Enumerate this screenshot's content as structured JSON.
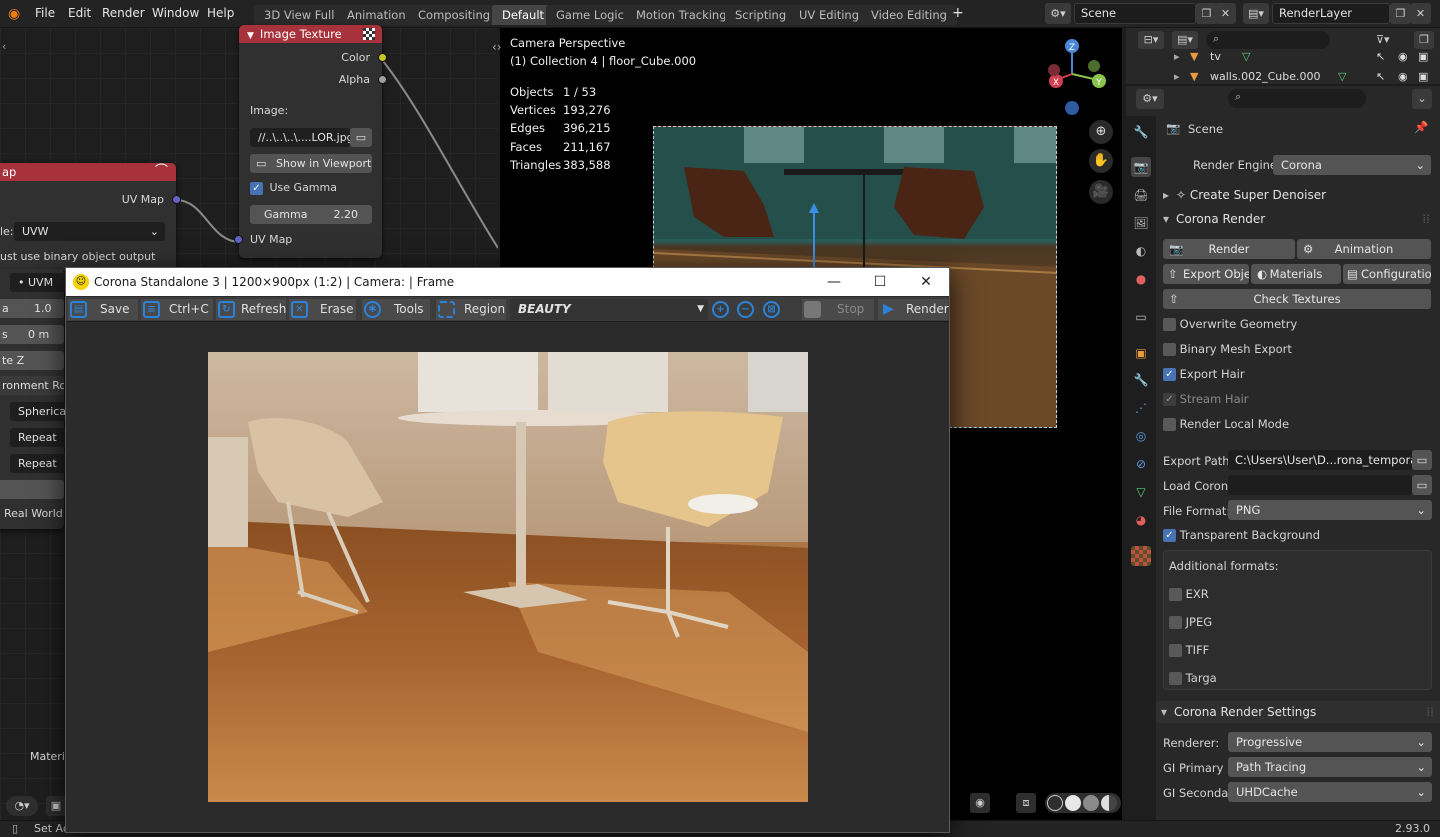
{
  "menubar": {
    "items": [
      "File",
      "Edit",
      "Render",
      "Window",
      "Help"
    ],
    "workspaces": [
      "3D View Full",
      "Animation",
      "Compositing",
      "Default",
      "Game Logic",
      "Motion Tracking",
      "Scripting",
      "UV Editing",
      "Video Editing"
    ],
    "active_workspace": "Default",
    "add_tab": "+",
    "scene": "Scene",
    "view_layer": "RenderLayer"
  },
  "node_editor": {
    "image_texture": {
      "title": "Image Texture",
      "out_color": "Color",
      "out_alpha": "Alpha",
      "image_label": "Image:",
      "image_file": "//..\\..\\..\\....LOR.jpg",
      "show_viewport": "Show in Viewport",
      "use_gamma": "Use Gamma",
      "gamma_label": "Gamma",
      "gamma_value": "2.20",
      "in_uvmap": "UV Map"
    },
    "uvmap_node": {
      "title": "ap",
      "out_uvmap": "UV Map",
      "mode_label": "le:",
      "mode_value": "UVW",
      "binary_text": "ust use binary object output"
    },
    "left_partial": {
      "uvmap_field": "UVM",
      "val1_label": "a",
      "val1": "1.0",
      "val2_label": "s",
      "val2": "0 m",
      "z_label": "te Z",
      "env_label": "ronment Rota",
      "spherical": "Spherical",
      "repeat1": "Repeat",
      "repeat2": "Repeat",
      "real_world": "Real World S",
      "material": "Materia"
    }
  },
  "viewport": {
    "mode": "Camera Perspective",
    "collection": "(1) Collection 4 | floor_Cube.000",
    "stats": [
      {
        "label": "Objects",
        "value": "1 / 53"
      },
      {
        "label": "Vertices",
        "value": "193,276"
      },
      {
        "label": "Edges",
        "value": "396,215"
      },
      {
        "label": "Faces",
        "value": "211,167"
      },
      {
        "label": "Triangles",
        "value": "383,588"
      }
    ],
    "gizmo": {
      "z": "Z",
      "x": "X",
      "y": "Y"
    }
  },
  "corona_window": {
    "title": "Corona Standalone 3 | 1200×900px (1:2) | Camera:  | Frame",
    "toolbar": {
      "save": "Save",
      "copy": "Ctrl+C",
      "refresh": "Refresh",
      "erase": "Erase",
      "tools": "Tools",
      "region": "Region",
      "channel": "BEAUTY",
      "stop": "Stop",
      "render": "Render"
    }
  },
  "outliner": {
    "items": [
      {
        "name": "tv"
      },
      {
        "name": "walls.002_Cube.000"
      }
    ]
  },
  "properties": {
    "scene_label": "Scene",
    "render_engine_label": "Render Engine",
    "render_engine": "Corona",
    "create_denoiser": "Create Super Denoiser",
    "corona_render_panel": "Corona Render",
    "btn_render": "Render",
    "btn_animation": "Animation",
    "btn_export": "Export Obje...",
    "btn_materials": "Materials",
    "btn_configuration": "Configuration",
    "btn_check_textures": "Check Textures",
    "checks": [
      {
        "label": "Overwrite Geometry",
        "checked": false
      },
      {
        "label": "Binary Mesh Export",
        "checked": false
      },
      {
        "label": "Export Hair",
        "checked": true
      },
      {
        "label": "Stream Hair",
        "checked": true
      },
      {
        "label": "Render Local Mode",
        "checked": false
      }
    ],
    "export_path_label": "Export Path:",
    "export_path": "C:\\Users\\User\\D...rona_temporary\\",
    "load_corona_label": "Load Coron...",
    "file_format_label": "File Format:",
    "file_format": "PNG",
    "transparent_bg": "Transparent Background",
    "additional_formats_label": "Additional formats:",
    "formats": [
      "EXR",
      "JPEG",
      "TIFF",
      "Targa"
    ],
    "render_settings_panel": "Corona Render Settings",
    "renderer_label": "Renderer:",
    "renderer": "Progressive",
    "gi_primary_label": "GI Primary ...",
    "gi_primary": "Path Tracing",
    "gi_secondary_label": "GI Seconda...",
    "gi_secondary": "UHDCache"
  },
  "statusbar": {
    "left": "Set Ac",
    "version": "2.93.0"
  },
  "colors": {
    "node_header": "#a8323c",
    "accent": "#4772b3",
    "corona_blue": "#2b82d9"
  }
}
